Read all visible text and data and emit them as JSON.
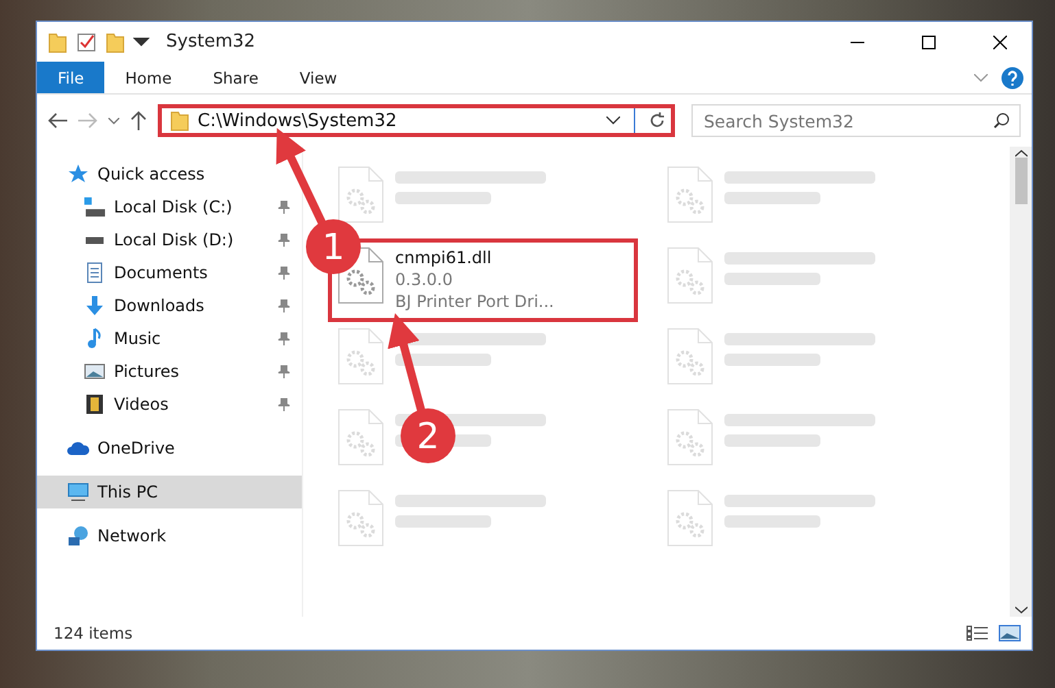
{
  "window": {
    "title": "System32"
  },
  "ribbon_tabs": [
    {
      "label": "File",
      "kind": "file",
      "selected": false
    },
    {
      "label": "Home",
      "kind": "tab",
      "selected": false
    },
    {
      "label": "Share",
      "kind": "tab",
      "selected": false
    },
    {
      "label": "View",
      "kind": "tab",
      "selected": false
    }
  ],
  "address_bar": {
    "path": "C:\\Windows\\System32",
    "highlighted": true
  },
  "search": {
    "placeholder": "Search System32"
  },
  "sidebar": {
    "items": [
      {
        "label": "Quick access",
        "kind": "star",
        "selected": false,
        "children": [
          {
            "label": "Local Disk (C:)",
            "kind": "system-drive",
            "pinned": true,
            "selected": false
          },
          {
            "label": "Local Disk (D:)",
            "kind": "drive",
            "pinned": true,
            "selected": false
          },
          {
            "label": "Documents",
            "kind": "documents",
            "pinned": true,
            "selected": false
          },
          {
            "label": "Downloads",
            "kind": "downloads",
            "pinned": true,
            "selected": false
          },
          {
            "label": "Music",
            "kind": "music",
            "pinned": true,
            "selected": false
          },
          {
            "label": "Pictures",
            "kind": "pictures",
            "pinned": true,
            "selected": false
          },
          {
            "label": "Videos",
            "kind": "videos",
            "pinned": true,
            "selected": false
          }
        ]
      },
      {
        "label": "OneDrive",
        "kind": "cloud",
        "selected": false
      },
      {
        "label": "This PC",
        "kind": "pc",
        "selected": true
      },
      {
        "label": "Network",
        "kind": "network",
        "selected": false
      }
    ]
  },
  "files": [
    {
      "kind": "blurred",
      "highlighted": false
    },
    {
      "kind": "blurred",
      "highlighted": false
    },
    {
      "kind": "file",
      "name": "cnmpi61.dll",
      "version": "0.3.0.0",
      "detail": "BJ Printer Port Dri...",
      "highlighted": true
    },
    {
      "kind": "blurred",
      "highlighted": false
    },
    {
      "kind": "blurred",
      "highlighted": false
    },
    {
      "kind": "blurred",
      "highlighted": false
    },
    {
      "kind": "blurred",
      "highlighted": false
    },
    {
      "kind": "blurred",
      "highlighted": false
    },
    {
      "kind": "blurred",
      "highlighted": false
    },
    {
      "kind": "blurred",
      "highlighted": false
    }
  ],
  "status_bar": {
    "count": "124 items"
  },
  "annotations": [
    {
      "label": "1"
    },
    {
      "label": "2"
    }
  ]
}
